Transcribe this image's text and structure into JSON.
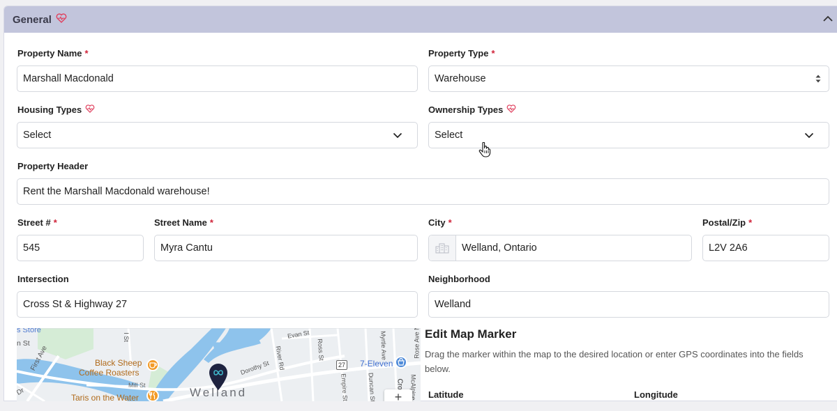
{
  "section": {
    "title": "General",
    "title_icon": "heart-pulse-icon",
    "collapse_icon": "chevron-up-icon"
  },
  "fields": {
    "property_name": {
      "label": "Property Name",
      "required": "*",
      "value": "Marshall Macdonald"
    },
    "property_type": {
      "label": "Property Type",
      "required": "*",
      "value": "Warehouse"
    },
    "housing_types": {
      "label": "Housing Types",
      "value": "Select"
    },
    "ownership_types": {
      "label": "Ownership Types",
      "value": "Select"
    },
    "property_header": {
      "label": "Property Header",
      "value": "Rent the Marshall Macdonald warehouse!"
    },
    "street_number": {
      "label": "Street #",
      "required": "*",
      "value": "545"
    },
    "street_name": {
      "label": "Street Name",
      "required": "*",
      "value": "Myra Cantu"
    },
    "city": {
      "label": "City",
      "required": "*",
      "value": "Welland, Ontario",
      "icon": "city-icon"
    },
    "postal_zip": {
      "label": "Postal/Zip",
      "required": "*",
      "value": "L2V 2A6"
    },
    "intersection": {
      "label": "Intersection",
      "value": "Cross St & Highway 27"
    },
    "neighborhood": {
      "label": "Neighborhood",
      "value": "Welland"
    }
  },
  "map": {
    "labels": {
      "store": "s Store",
      "st": "n St",
      "first_ave": "First Ave",
      "black_sheep_1": "Black Sheep",
      "black_sheep_2": "Coffee Roasters",
      "mill_st": "Mill St",
      "taris": "Taris on the Water",
      "welland": "Welland",
      "evan_st": "Evan St",
      "river_rd": "River Rd",
      "ross_st": "Ross St",
      "empire_st": "Empire St",
      "duncan_st": "Duncan St",
      "myrtle_ave": "Myrtle Ave",
      "mcalpine": "McAlpine",
      "rose_ave": "Rose Ave N",
      "hwy_27": "27",
      "seven_eleven": "7-Eleven",
      "cro": "Cro",
      "dorothy": "Dorothy St",
      "dr": "Dr",
      "i_st": "I St"
    },
    "zoom_in": "+"
  },
  "edit_marker": {
    "title": "Edit Map Marker",
    "description": "Drag the marker within the map to the desired location or enter GPS coordinates into the fields below.",
    "latitude_label": "Latitude",
    "longitude_label": "Longitude"
  },
  "colors": {
    "header_bg": "#c2c5dc",
    "required": "#d0243a",
    "heart": "#e0405e",
    "marker": "#1e2340",
    "water": "#8ec3ec"
  }
}
